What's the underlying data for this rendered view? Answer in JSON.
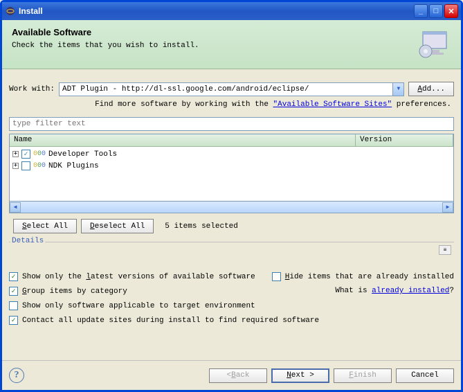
{
  "window": {
    "title": "Install"
  },
  "header": {
    "title": "Available Software",
    "subtitle": "Check the items that you wish to install."
  },
  "workwith": {
    "label": "Work with:",
    "value": "ADT Plugin - http://dl-ssl.google.com/android/eclipse/",
    "add_label": "Add..."
  },
  "findmore": {
    "prefix": "Find more software by working with the ",
    "link": "\"Available Software Sites\"",
    "suffix": " preferences."
  },
  "filter_placeholder": "type filter text",
  "tree": {
    "columns": {
      "name": "Name",
      "version": "Version"
    },
    "items": [
      {
        "label": "Developer Tools",
        "checked": true
      },
      {
        "label": "NDK Plugins",
        "checked": false
      }
    ]
  },
  "buttons": {
    "select_all": "Select All",
    "deselect_all": "Deselect All"
  },
  "selection_count": "5 items selected",
  "details_label": "Details",
  "options": {
    "latest": {
      "label": "Show only the latest versions of available software",
      "checked": true
    },
    "hide_installed": {
      "label": "Hide items that are already installed",
      "checked": false
    },
    "group": {
      "label": "Group items by category",
      "checked": true
    },
    "whatis_prefix": "What is ",
    "whatis_link": "already installed",
    "whatis_suffix": "?",
    "applicable": {
      "label": "Show only software applicable to target environment",
      "checked": false
    },
    "contact": {
      "label": "Contact all update sites during install to find required software",
      "checked": true
    }
  },
  "wizard": {
    "back": "< Back",
    "next": "Next >",
    "finish": "Finish",
    "cancel": "Cancel"
  }
}
